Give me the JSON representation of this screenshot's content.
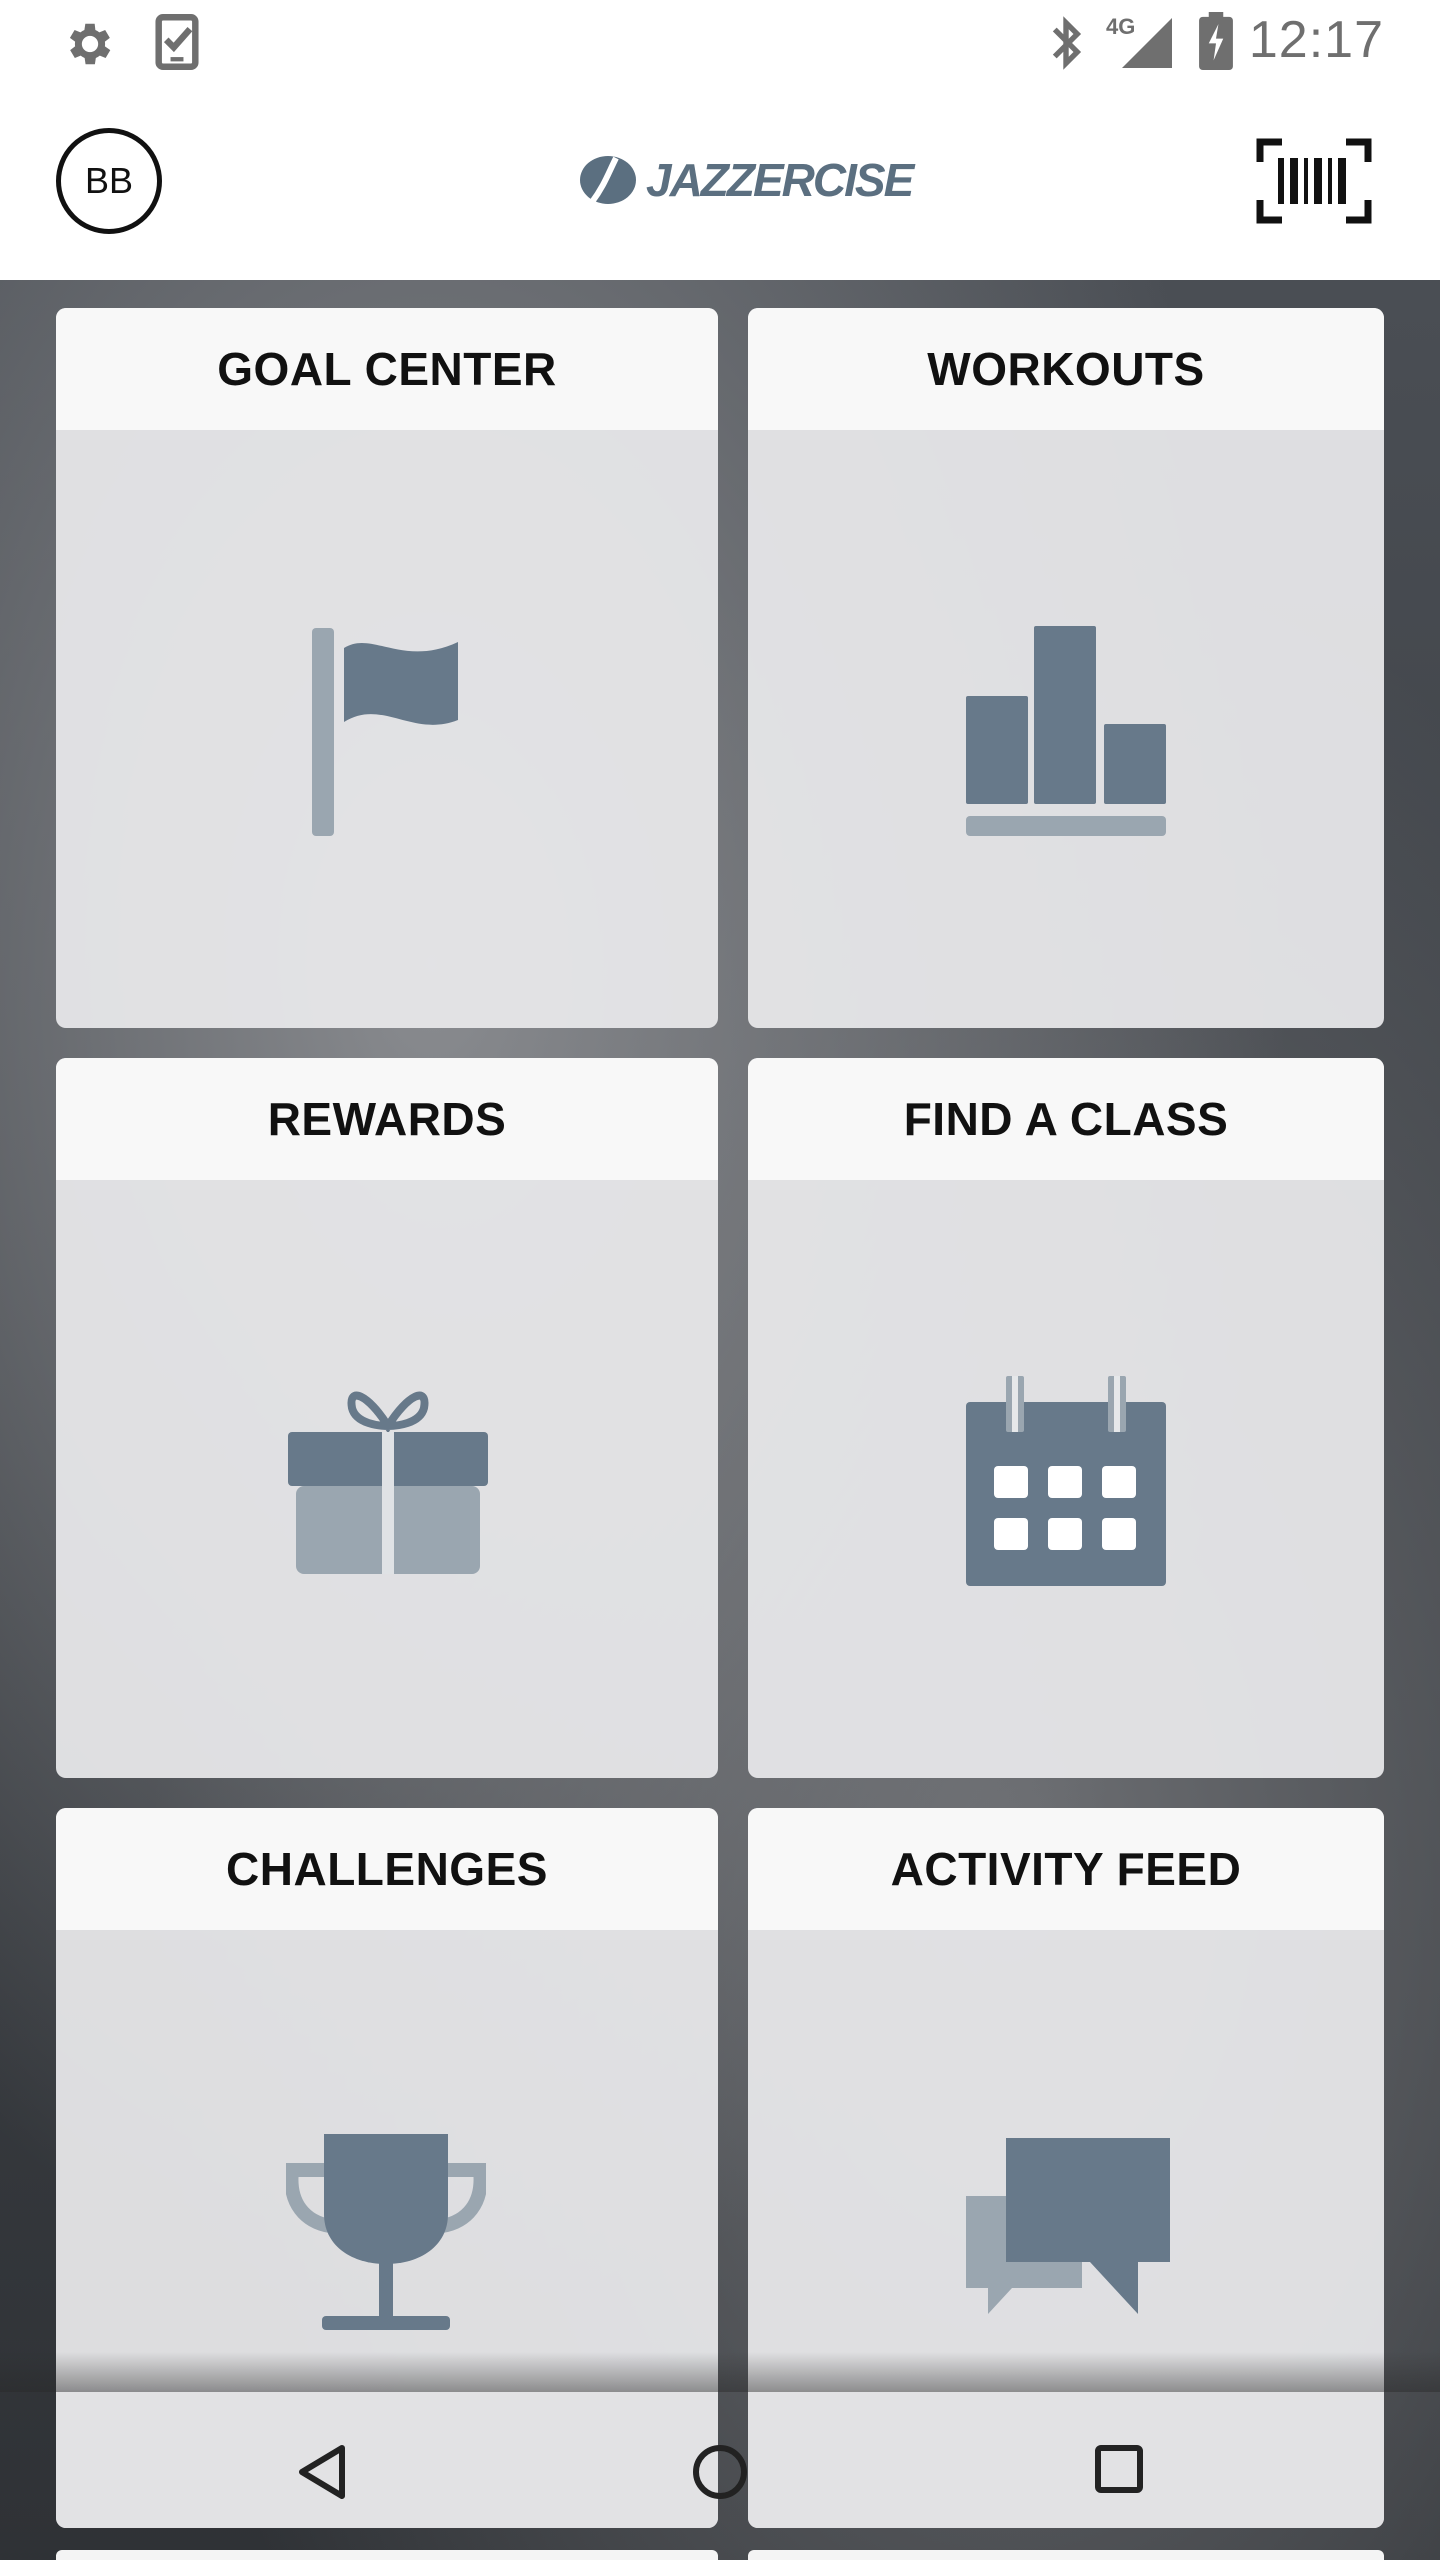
{
  "status_bar": {
    "time": "12:17",
    "network": "4G",
    "icons": [
      "settings-icon",
      "phone-check-icon",
      "bluetooth-icon",
      "signal-icon",
      "battery-charging-icon"
    ]
  },
  "header": {
    "avatar_initials": "BB",
    "logo_text": "JAZZERCISE",
    "barcode_icon": "barcode-scan-icon"
  },
  "tiles": [
    {
      "title": "GOAL CENTER",
      "icon": "flag-icon"
    },
    {
      "title": "WORKOUTS",
      "icon": "bar-chart-icon"
    },
    {
      "title": "REWARDS",
      "icon": "gift-icon"
    },
    {
      "title": "FIND A CLASS",
      "icon": "calendar-icon"
    },
    {
      "title": "CHALLENGES",
      "icon": "trophy-icon"
    },
    {
      "title": "ACTIVITY FEED",
      "icon": "chat-bubbles-icon"
    }
  ],
  "nav_bar": {
    "icons": [
      "back-icon",
      "home-icon",
      "recents-icon"
    ]
  },
  "colors": {
    "icon_dark": "#67798a",
    "icon_light": "#9aa6b0",
    "tile_header": "#f8f8f8",
    "tile_body": "#e8e8ea"
  }
}
